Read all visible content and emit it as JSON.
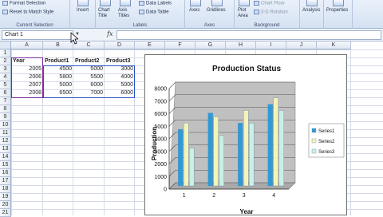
{
  "ribbon": {
    "current_selection": {
      "format_selection": "Format Selection",
      "reset_to_match_style": "Reset to Match Style",
      "label": "Current Selection"
    },
    "insert": {
      "label": "Insert"
    },
    "labels_group": {
      "chart_title": "Chart Title",
      "axis_titles": "Axis Titles",
      "data_labels": "Data Labels",
      "data_table": "Data Table",
      "label": "Labels"
    },
    "axes_group": {
      "axes": "Axes",
      "gridlines": "Gridlines",
      "label": "Axes"
    },
    "background_group": {
      "plot_area": "Plot Area",
      "chart_floor": "Chart Floor",
      "rotation_3d": "3-D Rotation",
      "label": "Background"
    },
    "analysis": "Analysis",
    "properties": "Properties"
  },
  "formula_bar": {
    "name_box": "Chart 1",
    "fx": "fx",
    "value": ""
  },
  "columns": [
    "A",
    "B",
    "C",
    "D",
    "E",
    "F",
    "G",
    "H",
    "I",
    "J",
    "K"
  ],
  "rows": [
    "1",
    "2",
    "3",
    "4",
    "5",
    "6",
    "7",
    "8",
    "9",
    "10",
    "11",
    "12",
    "13",
    "14",
    "15",
    "16",
    "17",
    "18",
    "19",
    "20",
    "21"
  ],
  "table": {
    "headers": [
      "Year",
      "Product1",
      "Product2",
      "Product3"
    ],
    "rows": [
      [
        "2005",
        "4500",
        "5000",
        "3000"
      ],
      [
        "2006",
        "5800",
        "5500",
        "4000"
      ],
      [
        "2007",
        "5000",
        "6000",
        "5000"
      ],
      [
        "2008",
        "6500",
        "7000",
        "6000"
      ]
    ]
  },
  "chart_data": {
    "type": "bar",
    "title": "Production Status",
    "xlabel": "Year",
    "ylabel": "Production",
    "categories": [
      "1",
      "2",
      "3",
      "4"
    ],
    "ylim": [
      0,
      8000
    ],
    "yticks": [
      "0",
      "1000",
      "2000",
      "3000",
      "4000",
      "5000",
      "6000",
      "7000",
      "8000"
    ],
    "grid": true,
    "legend_position": "right",
    "series": [
      {
        "name": "Series1",
        "values": [
          4500,
          5800,
          5000,
          6500
        ],
        "color": "#2e9bd6"
      },
      {
        "name": "Series2",
        "values": [
          5000,
          5500,
          6000,
          7000
        ],
        "color": "#f6f3b8"
      },
      {
        "name": "Series3",
        "values": [
          3000,
          4000,
          5000,
          6000
        ],
        "color": "#c9efe6"
      }
    ]
  }
}
